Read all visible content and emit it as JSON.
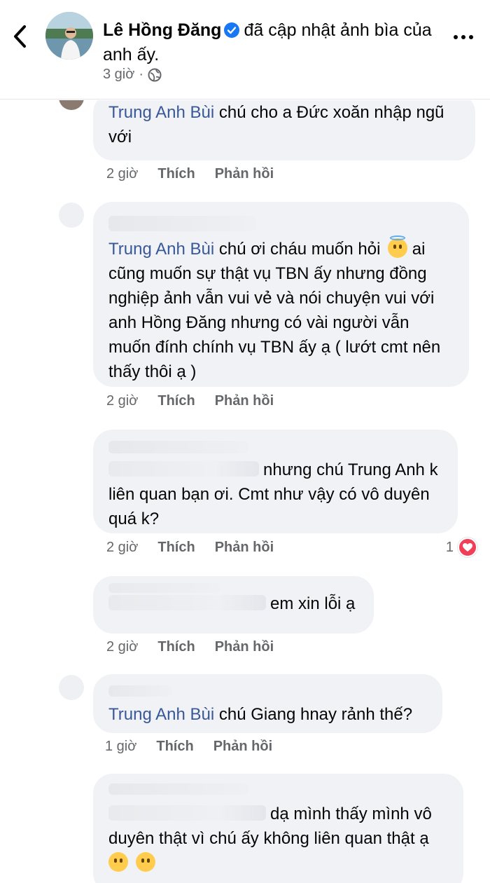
{
  "header": {
    "name": "Lê Hồng Đăng",
    "action": "đã cập nhật ảnh bìa của anh ấy.",
    "time": "3 giờ",
    "separator": "·"
  },
  "labels": {
    "like": "Thích",
    "reply": "Phản hồi"
  },
  "comments": [
    {
      "mention": "Trung Anh Bùi",
      "text": "chú cho a Đức xoăn nhập ngũ với",
      "time": "2 giờ"
    },
    {
      "mention": "Trung Anh Bùi",
      "text": "chú ơi cháu muốn hỏi",
      "text2": "ai cũng muốn sự thật vụ TBN ấy nhưng đồng nghiệp ảnh vẫn vui vẻ và nói chuyện vui với anh Hồng Đăng nhưng có vài người vẫn muốn đính chính vụ TBN ấy ạ ( lướt cmt nên thấy thôi ạ )",
      "time": "2 giờ"
    },
    {
      "text": "nhưng chú Trung Anh k liên quan bạn ơi. Cmt như vậy có vô duyên quá k?",
      "time": "2 giờ",
      "reactions": "1"
    },
    {
      "text": "em xin lỗi ạ",
      "time": "2 giờ"
    },
    {
      "mention": "Trung Anh Bùi",
      "text": "chú Giang hnay rảnh thế?",
      "time": "1 giờ"
    },
    {
      "text": "dạ mình thấy mình vô duyên thật vì chú ấy không liên quan thật ạ"
    }
  ],
  "icons": {
    "back": "chevron-left-icon",
    "verified": "verified-badge-icon",
    "globe": "globe-icon",
    "more": "more-dots-icon",
    "heart": "heart-reaction-icon"
  },
  "colors": {
    "mention": "#385898",
    "bubble": "#f0f2f5",
    "meta": "#65676b",
    "verified": "#1877f2",
    "heart": "#f33e58"
  }
}
